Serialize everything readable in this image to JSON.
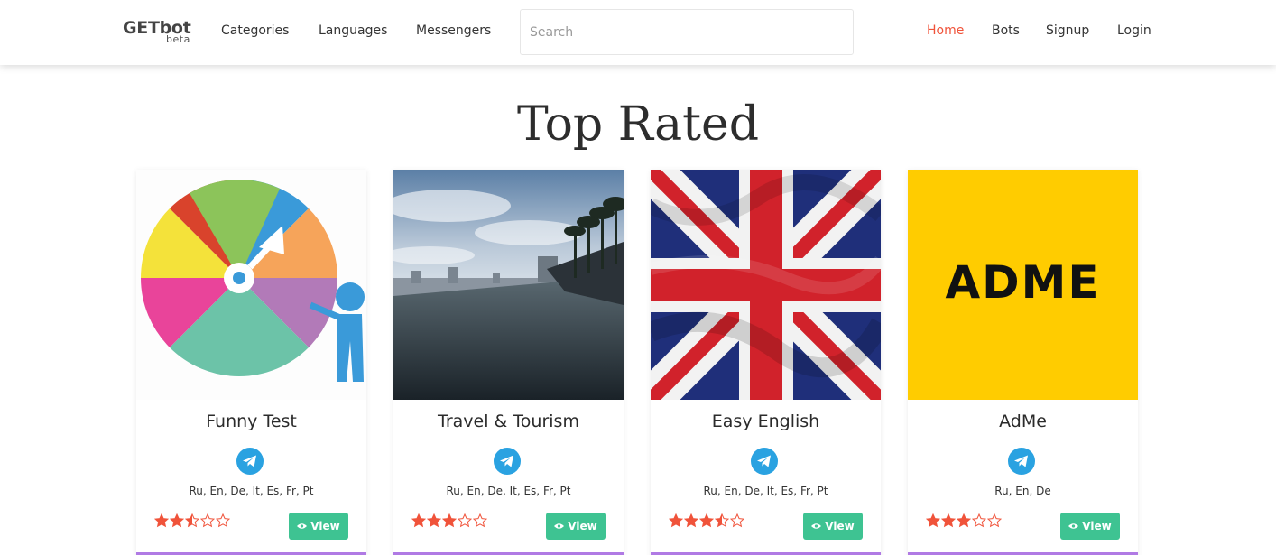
{
  "brand": {
    "name": "GETbot",
    "sub": "beta"
  },
  "nav_left": [
    "Categories",
    "Languages",
    "Messengers"
  ],
  "search": {
    "placeholder": "Search",
    "value": ""
  },
  "nav_right": [
    {
      "label": "Home",
      "active": true
    },
    {
      "label": "Bots",
      "active": false
    },
    {
      "label": "Signup",
      "active": false
    },
    {
      "label": "Login",
      "active": false
    }
  ],
  "page_title": "Top Rated",
  "cards": [
    {
      "title": "Funny Test",
      "messenger_icon": "telegram-icon",
      "languages": "Ru, En, De, It, Es, Fr, Pt",
      "rating": 2.5,
      "rating_max": 5,
      "button": "View",
      "image": "spinning-wheel-illustration"
    },
    {
      "title": "Travel & Tourism",
      "messenger_icon": "telegram-icon",
      "languages": "Ru, En, De, It, Es, Fr, Pt",
      "rating": 3,
      "rating_max": 5,
      "button": "View",
      "image": "infinity-pool-photo"
    },
    {
      "title": "Easy English",
      "messenger_icon": "telegram-icon",
      "languages": "Ru, En, De, It, Es, Fr, Pt",
      "rating": 3.5,
      "rating_max": 5,
      "button": "View",
      "image": "union-jack-flag"
    },
    {
      "title": "AdMe",
      "messenger_icon": "telegram-icon",
      "languages": "Ru, En, De",
      "rating": 3,
      "rating_max": 5,
      "button": "View",
      "image": "adme-logo",
      "logo_text": "ADME"
    }
  ],
  "colors": {
    "accent": "#f0533a",
    "button": "#3ec392",
    "star": "#f0533a",
    "telegram": "#2aa2e1",
    "card_bar": "#b07ae4"
  }
}
